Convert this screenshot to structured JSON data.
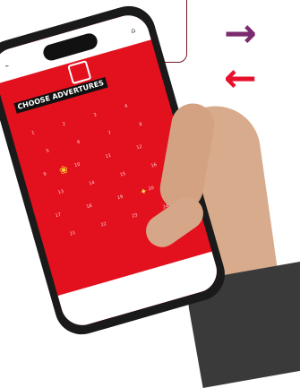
{
  "colors": {
    "brand_red": "#e3101d",
    "arrow_purple": "#7b2a6e",
    "arrow_red": "#e8112d",
    "callout_border": "#7a1826"
  },
  "icons": {
    "arrow_right": "→",
    "arrow_left": "←",
    "menu": "⌂"
  },
  "phone": {
    "title": "CHOOSE ADVERTURES",
    "days": [
      "1",
      "2",
      "3",
      "4",
      "5",
      "6",
      "7",
      "8",
      "9",
      "10",
      "11",
      "12",
      "13",
      "14",
      "15",
      "16",
      "17",
      "18",
      "19",
      "20",
      "21",
      "22",
      "23",
      "24"
    ]
  }
}
